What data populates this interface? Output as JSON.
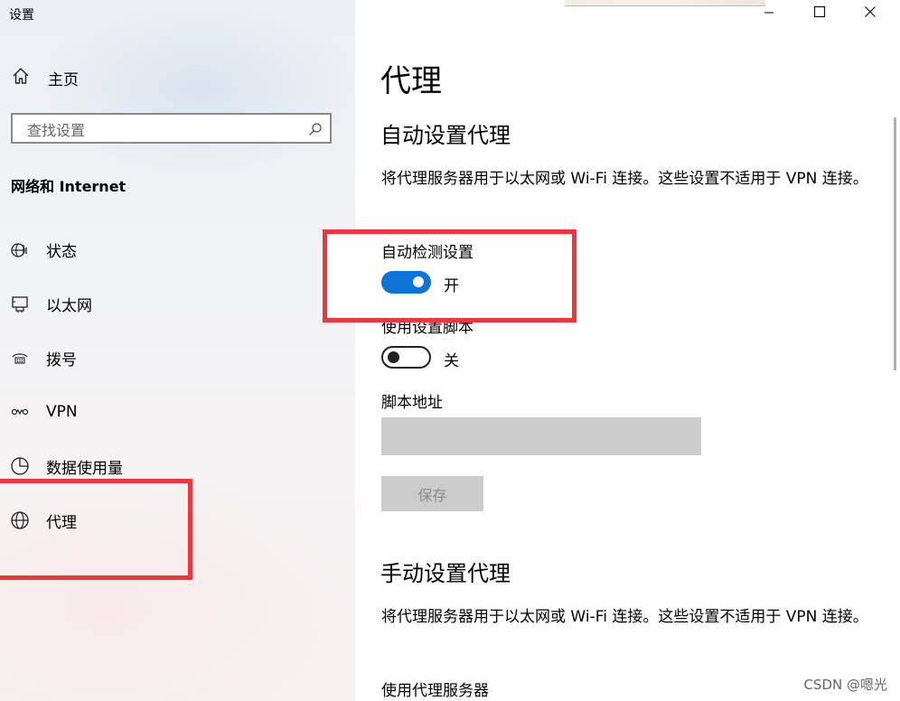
{
  "app": {
    "title": "设置"
  },
  "sidebar": {
    "home_label": "主页",
    "search_placeholder": "查找设置",
    "section_title": "网络和 Internet",
    "items": [
      {
        "label": "状态",
        "icon": "status-icon"
      },
      {
        "label": "以太网",
        "icon": "ethernet-icon"
      },
      {
        "label": "拨号",
        "icon": "dialup-icon"
      },
      {
        "label": "VPN",
        "icon": "vpn-icon"
      },
      {
        "label": "数据使用量",
        "icon": "data-usage-icon"
      },
      {
        "label": "代理",
        "icon": "globe-icon"
      }
    ]
  },
  "main": {
    "page_title": "代理",
    "auto_section": {
      "heading": "自动设置代理",
      "description": "将代理服务器用于以太网或 Wi-Fi 连接。这些设置不适用于 VPN 连接。",
      "detect_label": "自动检测设置",
      "detect_state": "开",
      "script_label": "使用设置脚本",
      "script_state": "关",
      "address_label": "脚本地址",
      "address_value": "",
      "save_label": "保存"
    },
    "manual_section": {
      "heading": "手动设置代理",
      "description": "将代理服务器用于以太网或 Wi-Fi 连接。这些设置不适用于 VPN 连接。",
      "use_proxy_label": "使用代理服务器"
    }
  },
  "watermark": "CSDN @嗯光",
  "colors": {
    "accent": "#0c74d9",
    "highlight": "#f0363a"
  }
}
